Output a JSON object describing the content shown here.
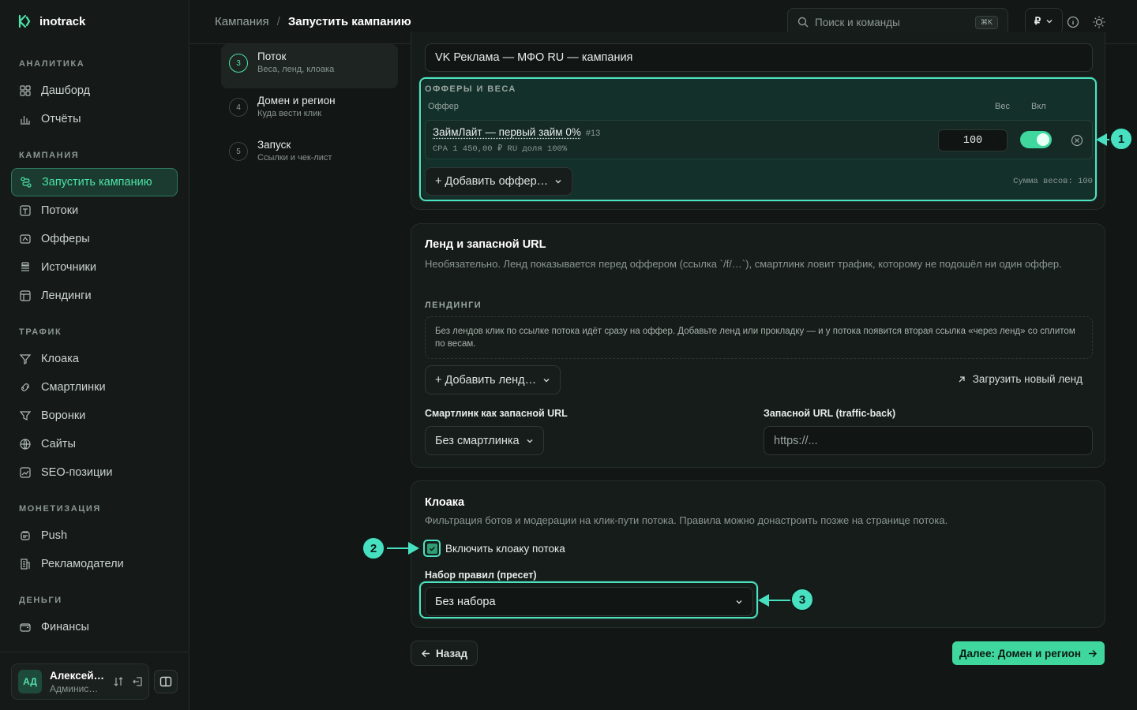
{
  "app": {
    "name": "inotrack"
  },
  "sidebar": {
    "sections": [
      {
        "title": "АНАЛИТИКА",
        "items": [
          {
            "label": "Дашборд",
            "icon": "grid-icon"
          },
          {
            "label": "Отчёты",
            "icon": "bar-chart-icon"
          }
        ]
      },
      {
        "title": "КАМПАНИЯ",
        "items": [
          {
            "label": "Запустить кампанию",
            "icon": "route-icon",
            "active": true
          },
          {
            "label": "Потоки",
            "icon": "stream-icon"
          },
          {
            "label": "Офферы",
            "icon": "offer-icon"
          },
          {
            "label": "Источники",
            "icon": "source-icon"
          },
          {
            "label": "Лендинги",
            "icon": "landing-icon"
          }
        ]
      },
      {
        "title": "ТРАФИК",
        "items": [
          {
            "label": "Клоака",
            "icon": "filter-icon"
          },
          {
            "label": "Смартлинки",
            "icon": "link-icon"
          },
          {
            "label": "Воронки",
            "icon": "funnel-icon"
          },
          {
            "label": "Сайты",
            "icon": "globe-icon"
          },
          {
            "label": "SEO-позиции",
            "icon": "trend-icon"
          }
        ]
      },
      {
        "title": "МОНЕТИЗАЦИЯ",
        "items": [
          {
            "label": "Push",
            "icon": "push-icon"
          },
          {
            "label": "Рекламодатели",
            "icon": "building-icon"
          }
        ]
      },
      {
        "title": "ДЕНЬГИ",
        "items": [
          {
            "label": "Финансы",
            "icon": "wallet-icon"
          }
        ]
      }
    ],
    "user": {
      "initials": "АД",
      "name": "Алексей…",
      "role": "Админис…"
    }
  },
  "topbar": {
    "breadcrumb": [
      "Кампания",
      "Запустить кампанию"
    ],
    "separator": "/",
    "search_placeholder": "Поиск и команды",
    "search_kbd": "⌘K",
    "currency": "₽"
  },
  "steps": [
    {
      "num": "3",
      "title": "Поток",
      "subtitle": "Веса, ленд, клоака",
      "active": true
    },
    {
      "num": "4",
      "title": "Домен и регион",
      "subtitle": "Куда вести клик"
    },
    {
      "num": "5",
      "title": "Запуск",
      "subtitle": "Ссылки и чек-лист"
    }
  ],
  "flow": {
    "name_value": "VK Реклама — МФО RU — кампания",
    "offers_title": "ОФФЕРЫ И ВЕСА",
    "col_offer": "Оффер",
    "col_weight": "Вес",
    "col_enabled": "Вкл",
    "offer": {
      "name": "ЗаймЛайт — первый займ 0%",
      "id": "#13",
      "meta": "CPA 1 450,00 ₽ RU доля 100%",
      "weight": "100",
      "enabled": true
    },
    "add_offer": "+ Добавить оффер…",
    "weight_sum": "Сумма весов: 100"
  },
  "landing": {
    "title": "Ленд и запасной URL",
    "desc": "Необязательно. Ленд показывается перед оффером (ссылка `/f/…`), смартлинк ловит трафик, которому не подошёл ни один оффер.",
    "section": "ЛЕНДИНГИ",
    "empty_text": "Без лендов клик по ссылке потока идёт сразу на оффер. Добавьте ленд или прокладку — и у потока появится вторая ссылка «через ленд» со сплитом по весам.",
    "add_landing": "+ Добавить ленд…",
    "upload_landing": "Загрузить новый ленд",
    "smartlink_label": "Смартлинк как запасной URL",
    "smartlink_value": "Без смартлинка",
    "fallback_label": "Запасной URL (traffic-back)",
    "fallback_placeholder": "https://..."
  },
  "cloak": {
    "title": "Клоака",
    "desc": "Фильтрация ботов и модерации на клик-пути потока. Правила можно донастроить позже на странице потока.",
    "checkbox_label": "Включить клоаку потока",
    "checked": true,
    "preset_label": "Набор правил (пресет)",
    "preset_value": "Без набора"
  },
  "footer": {
    "back": "Назад",
    "next": "Далее: Домен и регион"
  },
  "annotations": [
    "1",
    "2",
    "3"
  ],
  "colors": {
    "accent": "#4ce3a8",
    "highlight": "#47e0c0",
    "bg": "#121614"
  }
}
